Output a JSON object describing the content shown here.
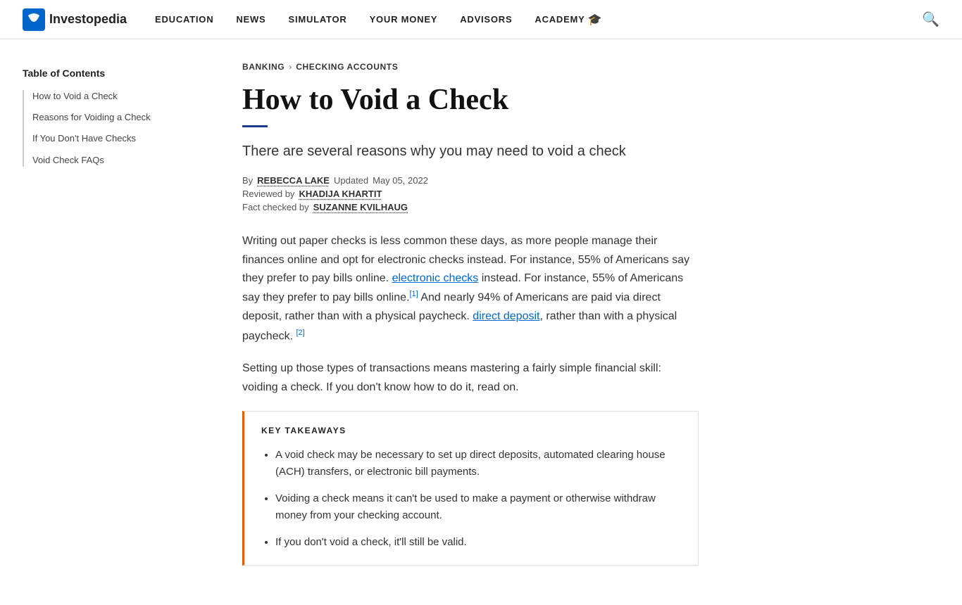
{
  "nav": {
    "logo_text": "Investopedia",
    "links": [
      {
        "label": "EDUCATION",
        "href": "#"
      },
      {
        "label": "NEWS",
        "href": "#"
      },
      {
        "label": "SIMULATOR",
        "href": "#"
      },
      {
        "label": "YOUR MONEY",
        "href": "#"
      },
      {
        "label": "ADVISORS",
        "href": "#"
      },
      {
        "label": "ACADEMY",
        "href": "#"
      }
    ]
  },
  "breadcrumb": {
    "items": [
      {
        "label": "BANKING",
        "href": "#"
      },
      {
        "label": "CHECKING ACCOUNTS",
        "href": "#"
      }
    ],
    "separator": "›"
  },
  "article": {
    "title": "How to Void a Check",
    "subtitle": "There are several reasons why you may need to void a check",
    "meta": {
      "by_label": "By",
      "author": "REBECCA LAKE",
      "updated_label": "Updated",
      "updated_date": "May 05, 2022",
      "reviewed_label": "Reviewed by",
      "reviewer": "KHADIJA KHARTIT",
      "fact_checked_label": "Fact checked by",
      "fact_checker": "SUZANNE KVILHAUG"
    },
    "body_p1": "Writing out paper checks is less common these days, as more people manage their finances online and opt for electronic checks instead. For instance, 55% of Americans say they prefer to pay bills online.",
    "body_p1_ref1": "[1]",
    "body_p1_cont": " And nearly 94% of Americans are paid via direct deposit, rather than with a physical paycheck.",
    "body_p1_ref2": "[2]",
    "body_p2": "Setting up those types of transactions means mastering a fairly simple financial skill: voiding a check. If you don't know how to do it, read on.",
    "links": {
      "electronic_checks": "electronic checks",
      "direct_deposit": "direct deposit"
    }
  },
  "toc": {
    "title": "Table of Contents",
    "items": [
      {
        "label": "How to Void a Check",
        "href": "#"
      },
      {
        "label": "Reasons for Voiding a Check",
        "href": "#"
      },
      {
        "label": "If You Don't Have Checks",
        "href": "#"
      },
      {
        "label": "Void Check FAQs",
        "href": "#"
      }
    ]
  },
  "takeaways": {
    "title": "KEY TAKEAWAYS",
    "items": [
      "A void check may be necessary to set up direct deposits, automated clearing house (ACH) transfers, or electronic bill payments.",
      "Voiding a check means it can't be used to make a payment or otherwise withdraw money from your checking account.",
      "If you don't void a check, it'll still be valid."
    ]
  }
}
